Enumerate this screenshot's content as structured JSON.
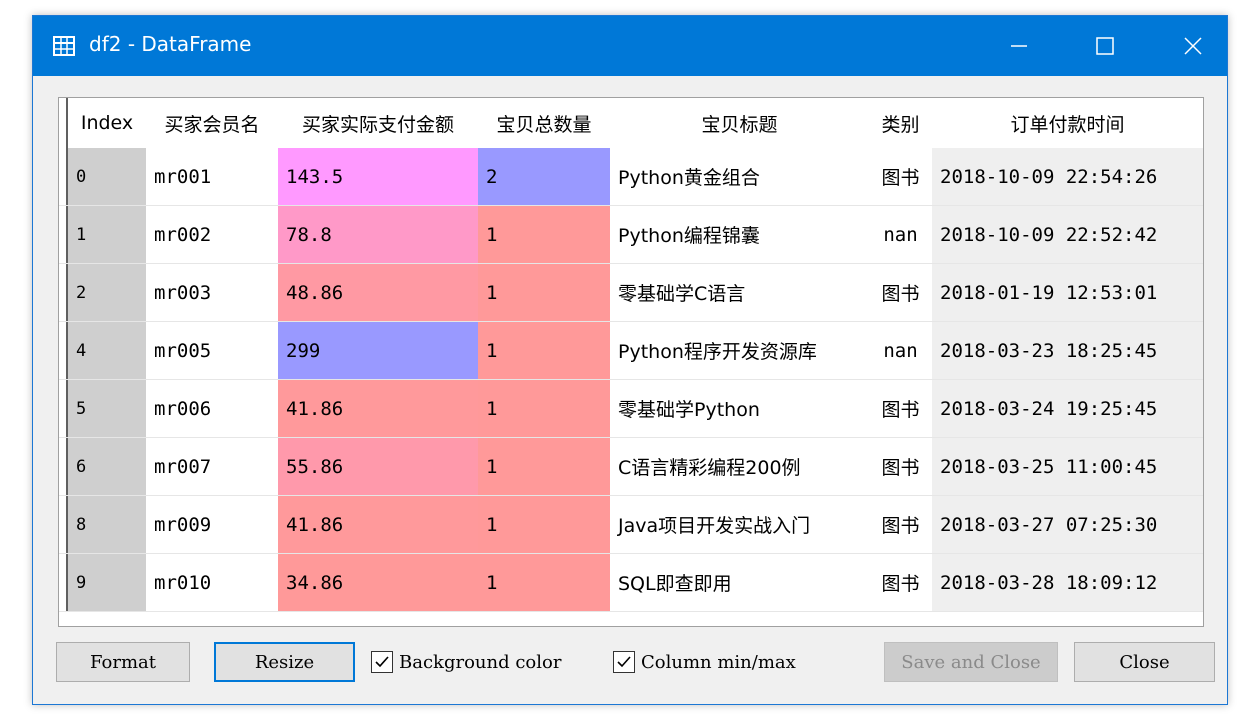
{
  "window": {
    "title": "df2 - DataFrame",
    "accent_color": "#0078d7",
    "icons": {
      "app": "table-icon",
      "minimize": "minimize-icon",
      "maximize": "maximize-icon",
      "close": "close-icon"
    }
  },
  "table": {
    "columns": [
      "Index",
      "买家会员名",
      "买家实际支付金额",
      "宝贝总数量",
      "宝贝标题",
      "类别",
      "订单付款时间"
    ],
    "rows": [
      {
        "index": "0",
        "member": "mr001",
        "paid": "143.5",
        "qty": "2",
        "title": "Python黄金组合",
        "category": "图书",
        "time": "2018-10-09 22:54:26",
        "paid_color": "#ff99ff",
        "qty_color": "#9999ff"
      },
      {
        "index": "1",
        "member": "mr002",
        "paid": "78.8",
        "qty": "1",
        "title": "Python编程锦囊",
        "category": "nan",
        "time": "2018-10-09 22:52:42",
        "paid_color": "#ff99c8",
        "qty_color": "#ff9999"
      },
      {
        "index": "2",
        "member": "mr003",
        "paid": "48.86",
        "qty": "1",
        "title": "零基础学C语言",
        "category": "图书",
        "time": "2018-01-19 12:53:01",
        "paid_color": "#ff99a3",
        "qty_color": "#ff9999"
      },
      {
        "index": "4",
        "member": "mr005",
        "paid": "299",
        "qty": "1",
        "title": "Python程序开发资源库",
        "category": "nan",
        "time": "2018-03-23 18:25:45",
        "paid_color": "#9999ff",
        "qty_color": "#ff9999"
      },
      {
        "index": "5",
        "member": "mr006",
        "paid": "41.86",
        "qty": "1",
        "title": "零基础学Python",
        "category": "图书",
        "time": "2018-03-24 19:25:45",
        "paid_color": "#ff999b",
        "qty_color": "#ff9999"
      },
      {
        "index": "6",
        "member": "mr007",
        "paid": "55.86",
        "qty": "1",
        "title": "C语言精彩编程200例",
        "category": "图书",
        "time": "2018-03-25 11:00:45",
        "paid_color": "#ff99ab",
        "qty_color": "#ff9999"
      },
      {
        "index": "8",
        "member": "mr009",
        "paid": "41.86",
        "qty": "1",
        "title": "Java项目开发实战入门",
        "category": "图书",
        "time": "2018-03-27 07:25:30",
        "paid_color": "#ff999b",
        "qty_color": "#ff9999"
      },
      {
        "index": "9",
        "member": "mr010",
        "paid": "34.86",
        "qty": "1",
        "title": "SQL即查即用",
        "category": "图书",
        "time": "2018-03-28 18:09:12",
        "paid_color": "#ff9999",
        "qty_color": "#ff9999"
      }
    ]
  },
  "buttons": {
    "format": "Format",
    "resize": "Resize",
    "save_close": "Save and Close",
    "close": "Close"
  },
  "checkboxes": [
    {
      "label": "Background color",
      "checked": true
    },
    {
      "label": "Column min/max",
      "checked": true
    }
  ]
}
